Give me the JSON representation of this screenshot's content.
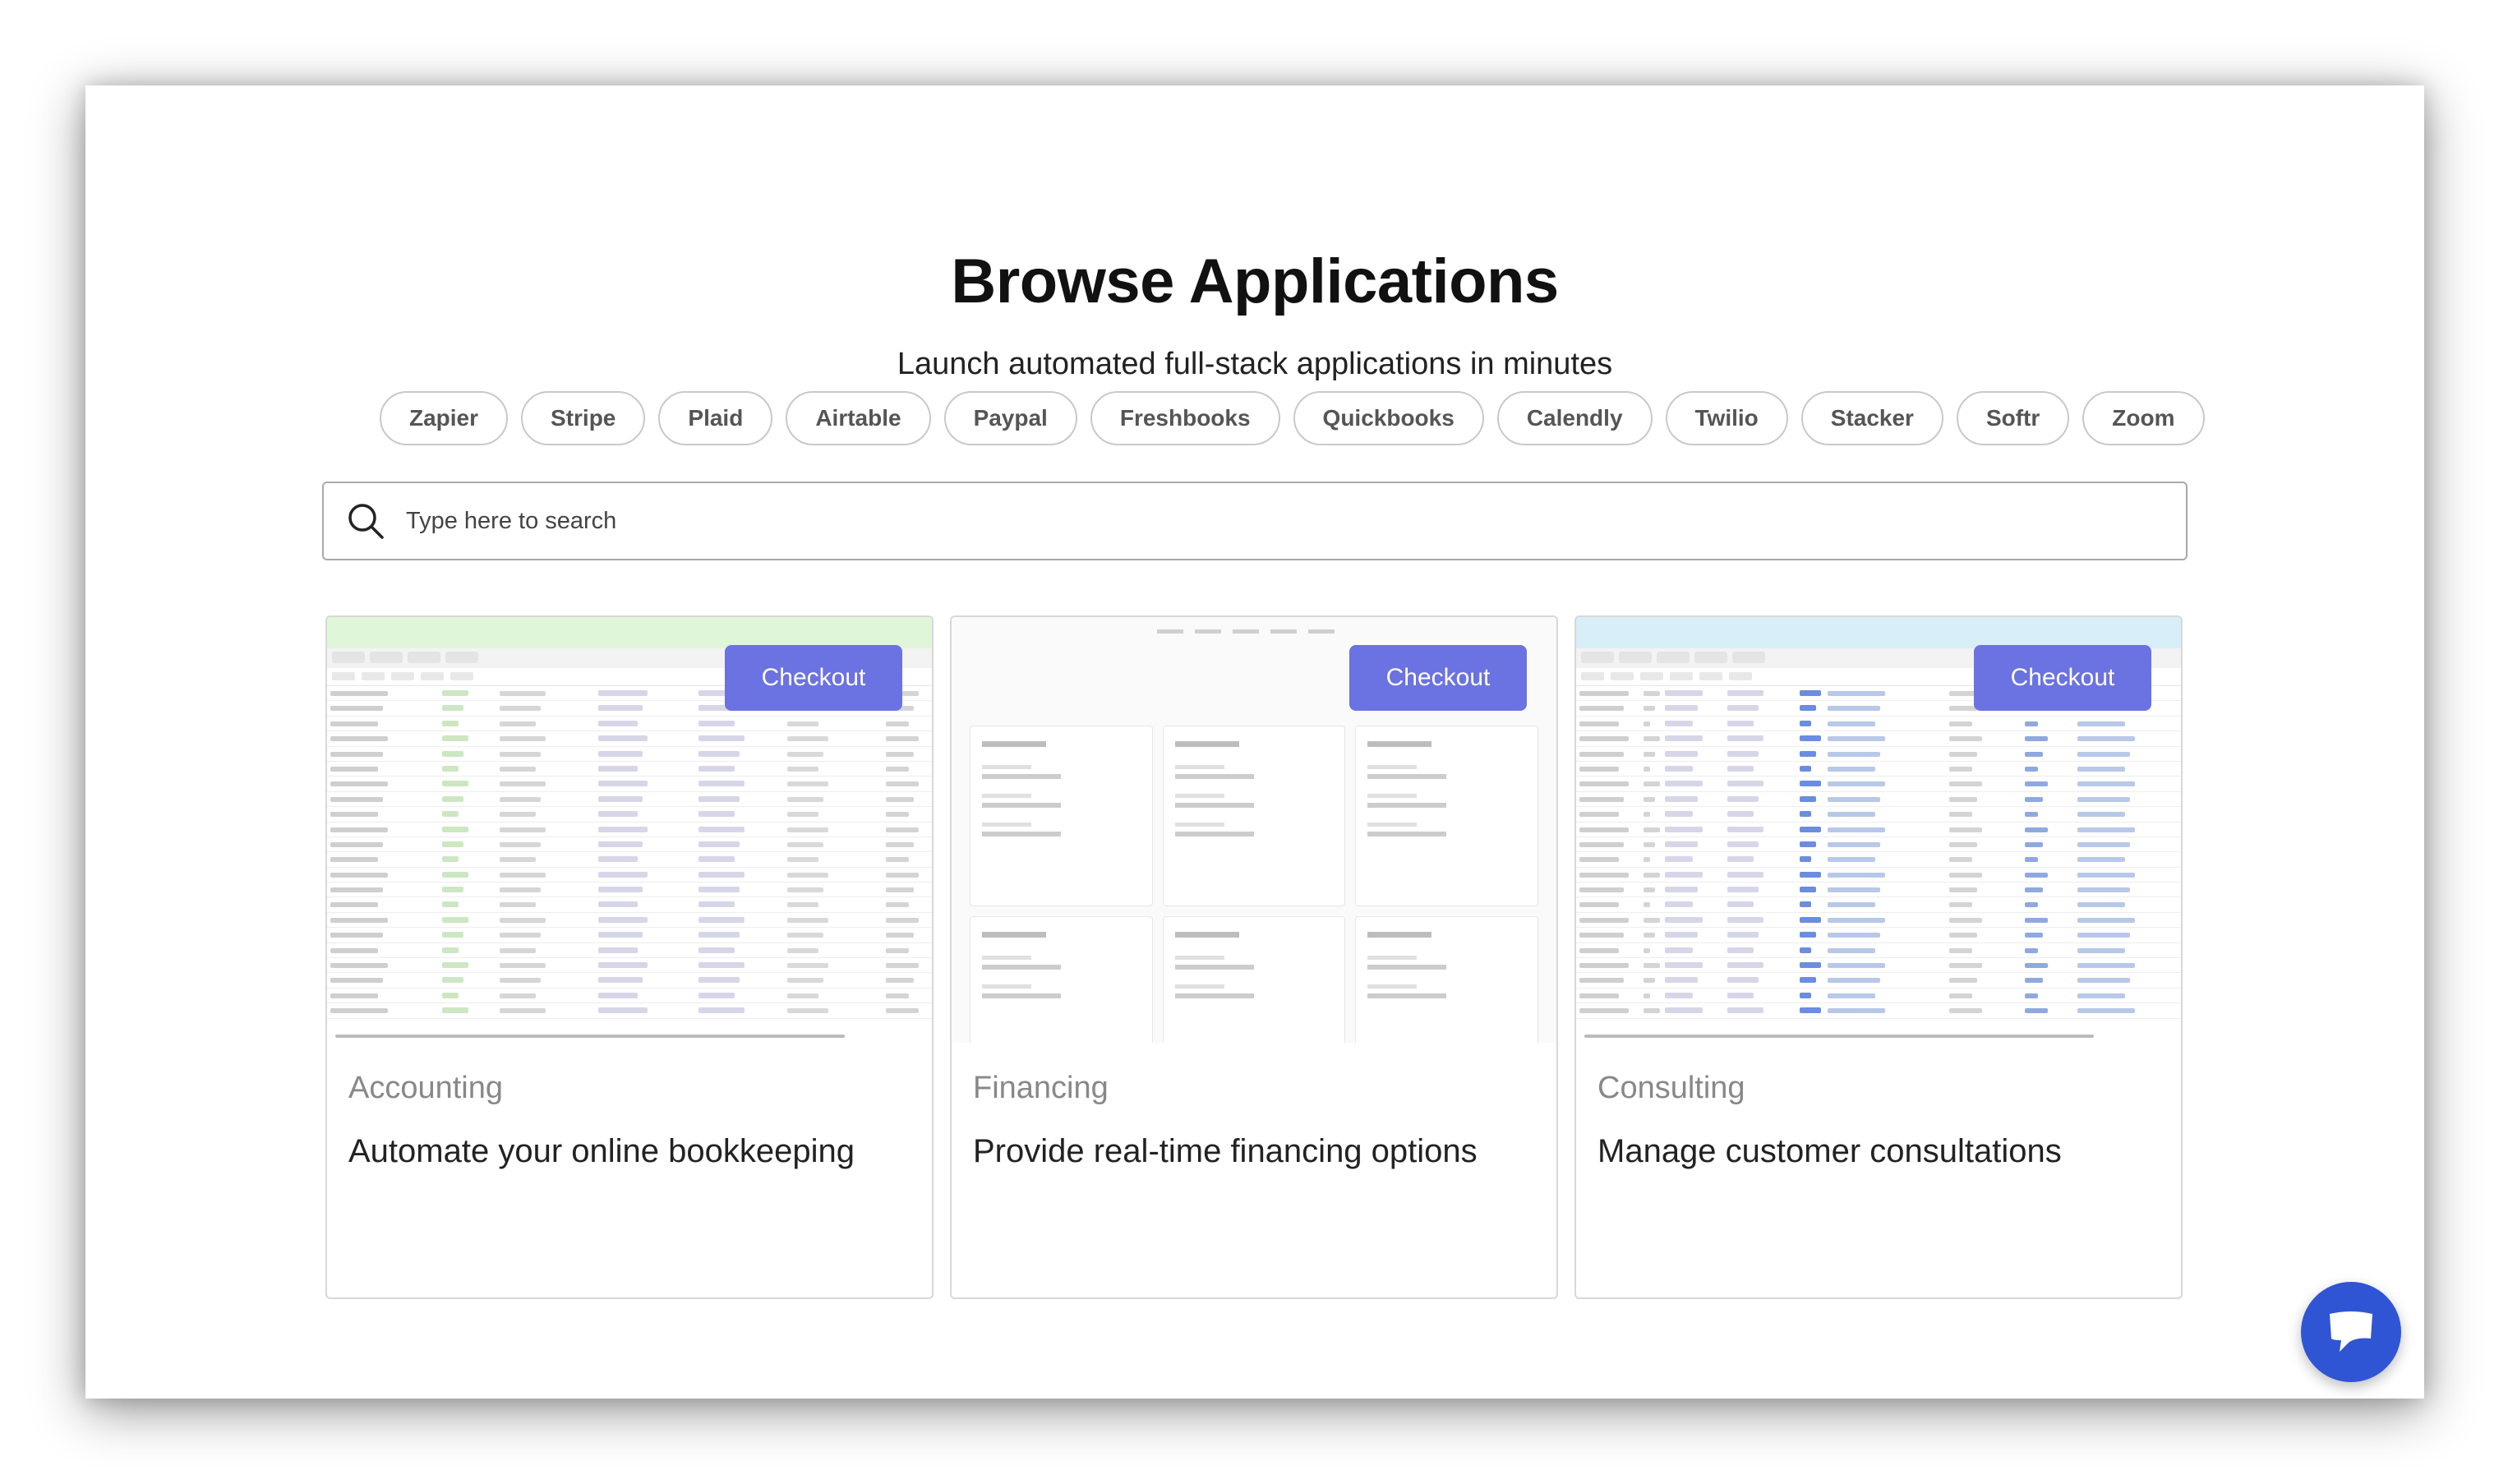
{
  "page": {
    "title": "Browse Applications",
    "subtitle": "Launch automated full-stack applications in minutes"
  },
  "filters": [
    "Zapier",
    "Stripe",
    "Plaid",
    "Airtable",
    "Paypal",
    "Freshbooks",
    "Quickbooks",
    "Calendly",
    "Twilio",
    "Stacker",
    "Softr",
    "Zoom"
  ],
  "search": {
    "placeholder": "Type here to search"
  },
  "cards": [
    {
      "category": "Accounting",
      "description": "Automate your online bookkeeping",
      "button": "Checkout"
    },
    {
      "category": "Financing",
      "description": "Provide real-time financing options",
      "button": "Checkout"
    },
    {
      "category": "Consulting",
      "description": "Manage customer consultations",
      "button": "Checkout"
    }
  ],
  "icons": {
    "search": "search-icon",
    "chat": "chat-icon"
  },
  "colors": {
    "checkout": "#6b72e2",
    "chat": "#2f55d4",
    "accounting_header": "#dff6d8",
    "consulting_header": "#d8eef8"
  }
}
